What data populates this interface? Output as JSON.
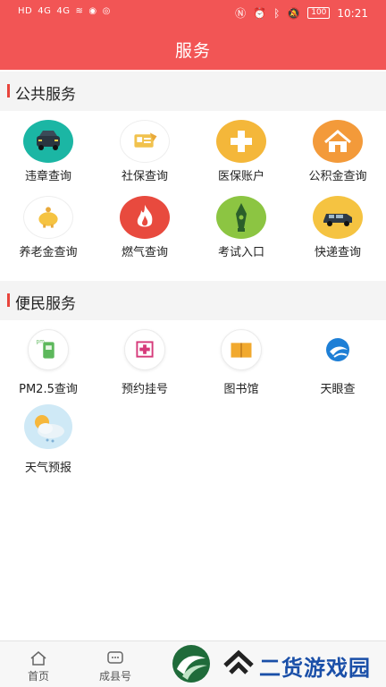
{
  "status_bar": {
    "left": [
      "HD",
      "4G",
      "4G",
      "wifi",
      "eye",
      "eye"
    ],
    "battery": "100",
    "time": "10:21"
  },
  "header": {
    "title": "服务"
  },
  "public_services": {
    "title": "公共服务",
    "items": [
      {
        "label": "违章查询",
        "icon": "car-icon",
        "color": "#1bb6a4"
      },
      {
        "label": "社保查询",
        "icon": "social-security-card-icon",
        "color": "#f1c24d"
      },
      {
        "label": "医保账户",
        "icon": "medical-cross-icon",
        "color": "#f4b73a"
      },
      {
        "label": "公积金查询",
        "icon": "house-icon",
        "color": "#f39a3a"
      },
      {
        "label": "养老金查询",
        "icon": "piggy-bank-icon",
        "color": "#f5c341"
      },
      {
        "label": "燃气查询",
        "icon": "flame-icon",
        "color": "#e84a3e"
      },
      {
        "label": "考试入口",
        "icon": "pen-nib-icon",
        "color": "#8cc542"
      },
      {
        "label": "快递查询",
        "icon": "van-icon",
        "color": "#f5c341"
      }
    ]
  },
  "convenience_services": {
    "title": "便民服务",
    "items": [
      {
        "label": "PM2.5查询",
        "icon": "pm25-meter-icon",
        "color": "#5db85c"
      },
      {
        "label": "预约挂号",
        "icon": "hospital-register-icon",
        "color": "#d63a7a"
      },
      {
        "label": "图书馆",
        "icon": "book-icon",
        "color": "#f1a92e"
      },
      {
        "label": "天眼查",
        "icon": "tianyancha-logo-icon",
        "color": "#1e7fd6"
      },
      {
        "label": "天气预报",
        "icon": "weather-icon",
        "color": "#8fd0ef"
      }
    ]
  },
  "bottom_nav": {
    "items": [
      {
        "label": "首页",
        "icon": "home-icon"
      },
      {
        "label": "成县号",
        "icon": "chat-icon"
      }
    ]
  },
  "watermark": {
    "text": "二货游戏园"
  },
  "colors": {
    "brand": "#f25555",
    "section_bar": "#e8453c",
    "section_bg": "#f4f4f4"
  }
}
